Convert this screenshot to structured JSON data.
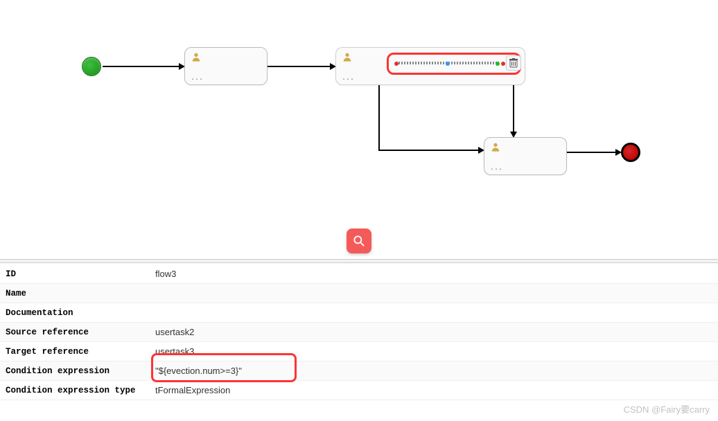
{
  "diagram": {
    "start": "Start Event",
    "end": "End Event",
    "task1_label": "...",
    "task2_label": "...",
    "task3_label": "...",
    "selected_flow": "flow3",
    "trash_tooltip": "Delete"
  },
  "search": {
    "label": "Search"
  },
  "props": {
    "id_label": "ID",
    "id_value": "flow3",
    "name_label": "Name",
    "name_value": "",
    "doc_label": "Documentation",
    "doc_value": "",
    "sourceref_label": "Source reference",
    "sourceref_value": "usertask2",
    "targetref_label": "Target reference",
    "targetref_value": "usertask3",
    "condexpr_label": "Condition expression",
    "condexpr_value": "\"${evection.num>=3}\"",
    "condtype_label": "Condition expression type",
    "condtype_value": "tFormalExpression"
  },
  "watermark": "CSDN @Fairy要carry"
}
